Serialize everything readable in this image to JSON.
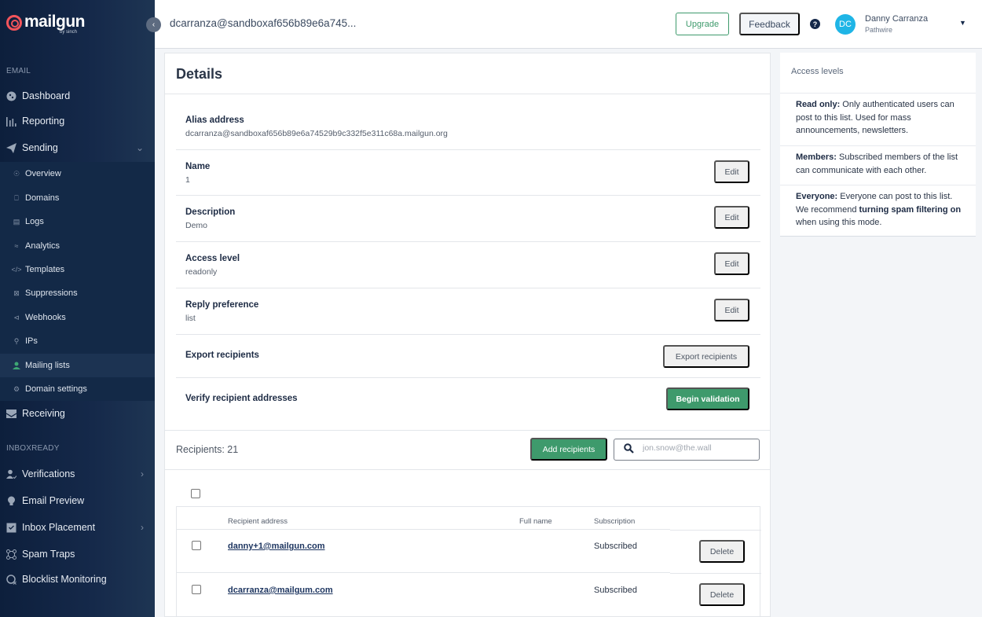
{
  "brand": {
    "name": "mailgun",
    "byline": "by sinch",
    "accent": "#f2545b"
  },
  "sidebar": {
    "sections": [
      {
        "label": "EMAIL"
      },
      {
        "label": "INBOXREADY"
      }
    ],
    "email_items": [
      {
        "label": "Dashboard",
        "icon": "dashboard-icon"
      },
      {
        "label": "Reporting",
        "icon": "bar-chart-icon"
      },
      {
        "label": "Sending",
        "icon": "paper-plane-icon",
        "expanded": true
      }
    ],
    "sending_sub_items": [
      {
        "label": "Overview",
        "icon": "eye-icon"
      },
      {
        "label": "Domains",
        "icon": "globe-icon"
      },
      {
        "label": "Logs",
        "icon": "log-file-icon"
      },
      {
        "label": "Analytics",
        "icon": "analytics-icon"
      },
      {
        "label": "Templates",
        "icon": "code-icon"
      },
      {
        "label": "Suppressions",
        "icon": "suppression-icon"
      },
      {
        "label": "Webhooks",
        "icon": "webhook-icon"
      },
      {
        "label": "IPs",
        "icon": "location-pin-icon"
      },
      {
        "label": "Mailing lists",
        "icon": "person-icon",
        "active": true
      },
      {
        "label": "Domain settings",
        "icon": "gear-icon"
      }
    ],
    "receiving": {
      "label": "Receiving",
      "icon": "inbox-icon"
    },
    "inboxready_items": [
      {
        "label": "Verifications",
        "icon": "user-check-icon",
        "has_submenu": true
      },
      {
        "label": "Email Preview",
        "icon": "lightbulb-icon"
      },
      {
        "label": "Inbox Placement",
        "icon": "inbox-check-icon",
        "has_submenu": true
      },
      {
        "label": "Spam Traps",
        "icon": "network-icon"
      },
      {
        "label": "Blocklist Monitoring",
        "icon": "blocklist-icon"
      }
    ]
  },
  "header": {
    "title": "dcarranza@sandboxaf656b89e6a745...",
    "upgrade_label": "Upgrade",
    "feedback_label": "Feedback",
    "help_label": "?",
    "user": {
      "initials": "DC",
      "name": "Danny Carranza",
      "org": "Pathwire"
    }
  },
  "details": {
    "title": "Details",
    "alias": {
      "label": "Alias address",
      "value": "dcarranza@sandboxaf656b89e6a74529b9c332f5e311c68a.mailgun.org"
    },
    "fields": [
      {
        "label": "Name",
        "value": "1",
        "action": "Edit"
      },
      {
        "label": "Description",
        "value": "Demo",
        "action": "Edit"
      },
      {
        "label": "Access level",
        "value": "readonly",
        "action": "Edit"
      },
      {
        "label": "Reply preference",
        "value": "list",
        "action": "Edit"
      }
    ],
    "export": {
      "label": "Export recipients",
      "action": "Export recipients"
    },
    "verify": {
      "label": "Verify recipient addresses",
      "action": "Begin validation"
    }
  },
  "recipients": {
    "count_label": "Recipients: 21",
    "add_label": "Add recipients",
    "search_placeholder": "jon.snow@the.wall",
    "search_value": "",
    "columns": [
      "Recipient address",
      "Full name",
      "Subscription"
    ],
    "rows": [
      {
        "address": "danny+1@mailgun.com",
        "full_name": "",
        "subscription": "Subscribed",
        "action": "Delete"
      },
      {
        "address": "dcarranza@mailgum.com",
        "full_name": "",
        "subscription": "Subscribed",
        "action": "Delete"
      }
    ]
  },
  "access_levels": {
    "title": "Access levels",
    "items": [
      {
        "term": "Read only:",
        "text": " Only authenticated users can post to this list. Used for mass announcements, newsletters."
      },
      {
        "term": "Members:",
        "text": " Subscribed members of the list can communicate with each other."
      },
      {
        "term": "Everyone:",
        "text_before": " Everyone can post to this list. We recommend ",
        "emphasis": "turning spam filtering on",
        "text_after": " when using this mode."
      }
    ]
  },
  "colors": {
    "primary_green": "#3e9a6c",
    "sidebar_bg": "#0d1f3c",
    "avatar": "#1fb5e6"
  }
}
